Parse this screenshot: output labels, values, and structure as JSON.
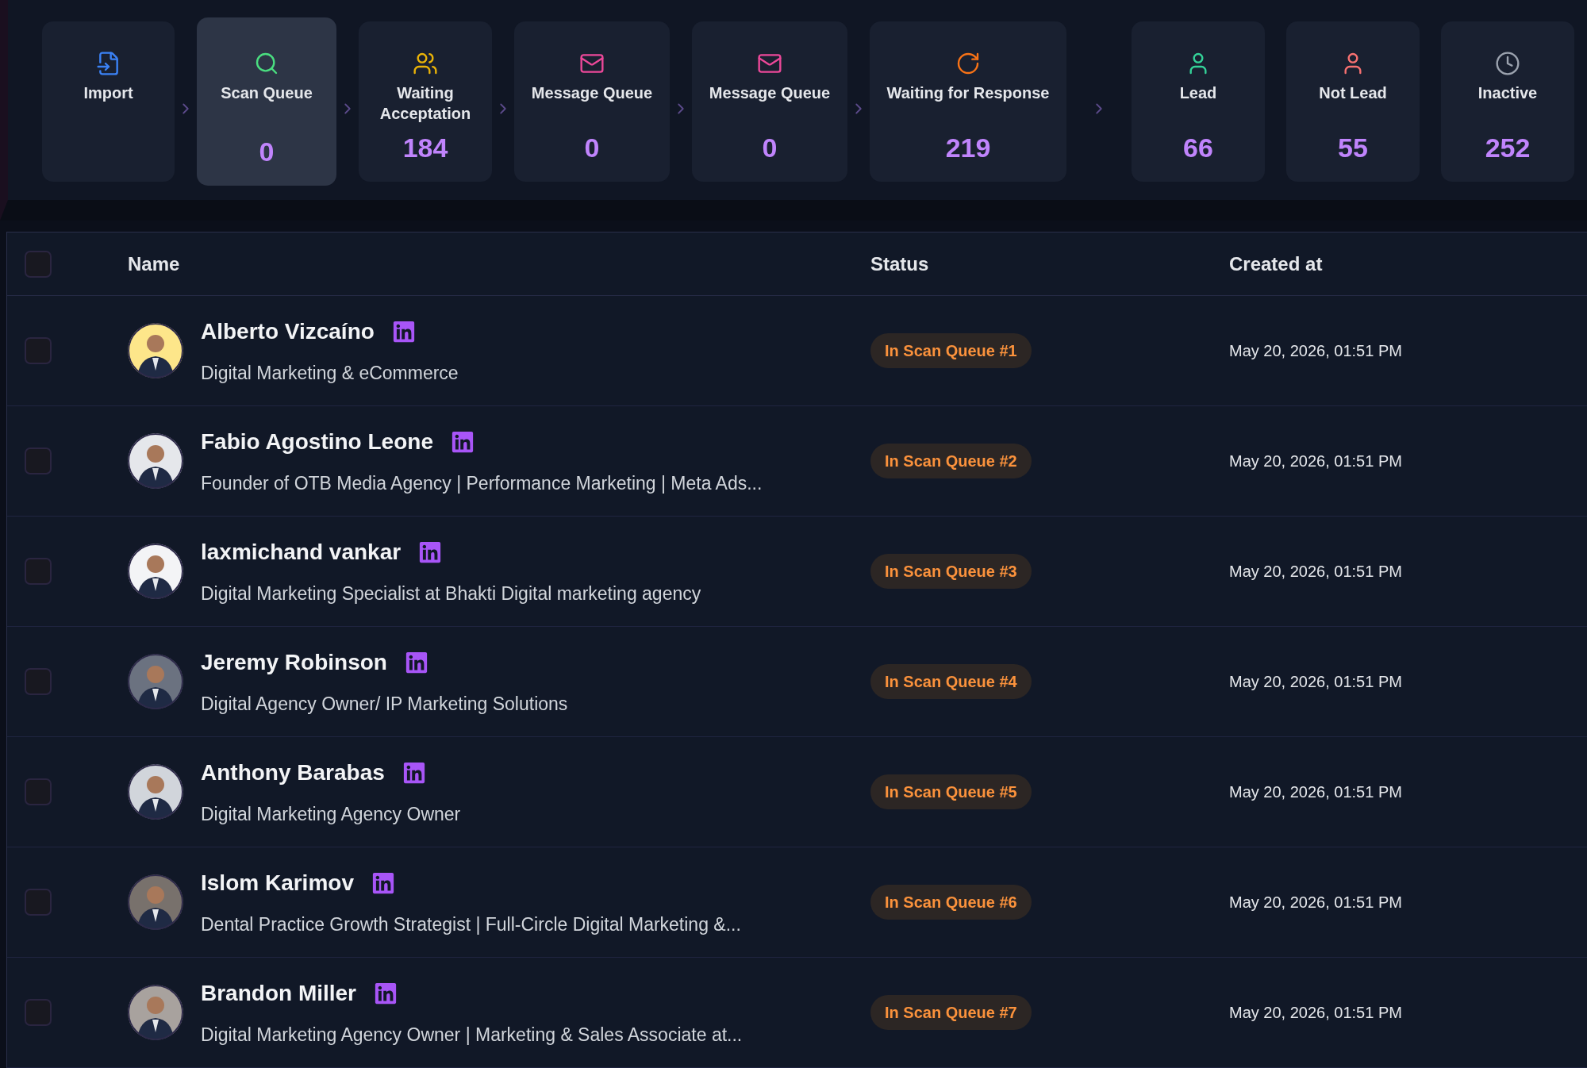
{
  "pipeline": [
    {
      "kind": "import",
      "label": "Import",
      "selected": false
    },
    {
      "kind": "scan",
      "label": "Scan Queue",
      "count": "0",
      "selected": true
    },
    {
      "kind": "waiting",
      "label": "Waiting Acceptation",
      "count": "184",
      "selected": false
    },
    {
      "kind": "message",
      "label": "Message Queue",
      "count": "0",
      "selected": false
    },
    {
      "kind": "message",
      "label": "Message Queue",
      "count": "0",
      "selected": false
    },
    {
      "kind": "response",
      "label": "Waiting for Response",
      "count": "219",
      "selected": false
    }
  ],
  "outcomes": [
    {
      "kind": "lead",
      "label": "Lead",
      "count": "66",
      "selected": false
    },
    {
      "kind": "notlead",
      "label": "Not Lead",
      "count": "55",
      "selected": false
    },
    {
      "kind": "inactive",
      "label": "Inactive",
      "count": "252",
      "selected": false
    }
  ],
  "table": {
    "select_all": {
      "checked": false
    },
    "columns": [
      "Name",
      "Status",
      "Created at"
    ],
    "rows": [
      {
        "checked": false,
        "name": "Alberto Vizcaíno",
        "headline": "Digital Marketing & eCommerce",
        "status": "In Scan Queue #1",
        "created_at": "May 20, 2026, 01:51 PM"
      },
      {
        "checked": false,
        "name": "Fabio Agostino Leone",
        "headline": "Founder of OTB Media Agency | Performance Marketing | Meta Ads...",
        "status": "In Scan Queue #2",
        "created_at": "May 20, 2026, 01:51 PM"
      },
      {
        "checked": false,
        "name": "laxmichand vankar",
        "headline": "Digital Marketing Specialist at Bhakti Digital marketing agency",
        "status": "In Scan Queue #3",
        "created_at": "May 20, 2026, 01:51 PM"
      },
      {
        "checked": false,
        "name": "Jeremy Robinson",
        "headline": "Digital Agency Owner/ IP Marketing Solutions",
        "status": "In Scan Queue #4",
        "created_at": "May 20, 2026, 01:51 PM"
      },
      {
        "checked": false,
        "name": "Anthony Barabas",
        "headline": "Digital Marketing Agency Owner",
        "status": "In Scan Queue #5",
        "created_at": "May 20, 2026, 01:51 PM"
      },
      {
        "checked": false,
        "name": "Islom Karimov",
        "headline": "Dental Practice Growth Strategist | Full-Circle Digital Marketing &...",
        "status": "In Scan Queue #6",
        "created_at": "May 20, 2026, 01:51 PM"
      },
      {
        "checked": false,
        "name": "Brandon Miller",
        "headline": "Digital Marketing Agency Owner | Marketing & Sales Associate at...",
        "status": "In Scan Queue #7",
        "created_at": "May 20, 2026, 01:51 PM"
      }
    ]
  }
}
